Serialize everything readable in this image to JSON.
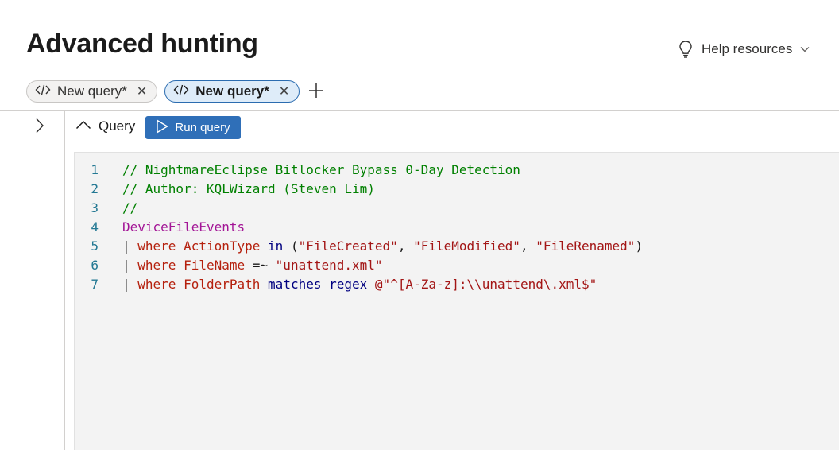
{
  "header": {
    "title": "Advanced hunting",
    "help_label": "Help resources"
  },
  "tabs": [
    {
      "label": "New query*",
      "active": false
    },
    {
      "label": "New query*",
      "active": true
    }
  ],
  "query_panel": {
    "label": "Query",
    "run_label": "Run query"
  },
  "editor": {
    "line_numbers": [
      "1",
      "2",
      "3",
      "4",
      "5",
      "6",
      "7"
    ],
    "lines": [
      [
        {
          "t": "// NightmareEclipse Bitlocker Bypass 0-Day Detection",
          "k": "comment"
        }
      ],
      [
        {
          "t": "// Author: KQLWizard (Steven Lim)",
          "k": "comment"
        }
      ],
      [
        {
          "t": "//",
          "k": "comment"
        }
      ],
      [
        {
          "t": "DeviceFileEvents",
          "k": "table"
        }
      ],
      [
        {
          "t": "| ",
          "k": "pipe"
        },
        {
          "t": "where",
          "k": "kw"
        },
        {
          "t": " ",
          "k": "plain"
        },
        {
          "t": "ActionType",
          "k": "col"
        },
        {
          "t": " ",
          "k": "plain"
        },
        {
          "t": "in",
          "k": "op"
        },
        {
          "t": " (",
          "k": "plain"
        },
        {
          "t": "\"FileCreated\"",
          "k": "str"
        },
        {
          "t": ", ",
          "k": "plain"
        },
        {
          "t": "\"FileModified\"",
          "k": "str"
        },
        {
          "t": ", ",
          "k": "plain"
        },
        {
          "t": "\"FileRenamed\"",
          "k": "str"
        },
        {
          "t": ")",
          "k": "plain"
        }
      ],
      [
        {
          "t": "| ",
          "k": "pipe"
        },
        {
          "t": "where",
          "k": "kw"
        },
        {
          "t": " ",
          "k": "plain"
        },
        {
          "t": "FileName",
          "k": "col"
        },
        {
          "t": " =~ ",
          "k": "plain"
        },
        {
          "t": "\"unattend.xml\"",
          "k": "str"
        }
      ],
      [
        {
          "t": "| ",
          "k": "pipe"
        },
        {
          "t": "where",
          "k": "kw"
        },
        {
          "t": " ",
          "k": "plain"
        },
        {
          "t": "FolderPath",
          "k": "col"
        },
        {
          "t": " ",
          "k": "plain"
        },
        {
          "t": "matches regex",
          "k": "op"
        },
        {
          "t": " ",
          "k": "plain"
        },
        {
          "t": "@\"^[A-Za-z]:\\\\unattend\\.xml$\"",
          "k": "str"
        }
      ]
    ]
  },
  "colors": {
    "accent": "#2f6fb8",
    "comment": "#008000",
    "table": "#a31596",
    "keyword": "#b5200d",
    "operator": "#000080",
    "string": "#a31515",
    "line_number": "#237893",
    "editor_bg": "#f3f3f3"
  },
  "icons": {
    "help": "lightbulb-icon",
    "tab": "code-icon",
    "expand": "chevron-right-icon",
    "collapse": "chevron-up-icon",
    "run": "play-icon"
  }
}
